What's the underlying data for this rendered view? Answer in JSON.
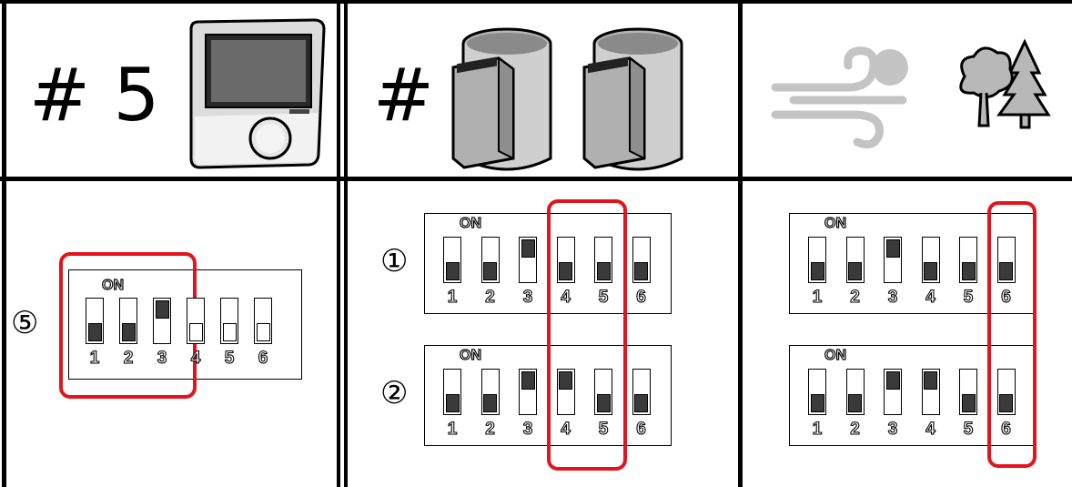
{
  "headers": {
    "col1_label": "# 5",
    "col2_label": "#"
  },
  "icons": {
    "col1": "thermostat-icon",
    "col2": "heating-unit-icon",
    "col3": [
      "wind-icon",
      "trees-icon"
    ]
  },
  "colors": {
    "highlight": "#e3141c",
    "lever": "#3a3a3a",
    "grey_icon": "#b8b8b8"
  },
  "dip_label_on": "ON",
  "switch_numbers": [
    "1",
    "2",
    "3",
    "4",
    "5",
    "6"
  ],
  "panels": {
    "col1": {
      "marker": "⑤",
      "switches": [
        "off",
        "off",
        "on",
        "off",
        "off",
        "off"
      ],
      "hollow": [
        false,
        false,
        false,
        true,
        true,
        true
      ],
      "highlight": "switches 1-3"
    },
    "col2": [
      {
        "marker": "①",
        "switches": [
          "off",
          "off",
          "on",
          "off",
          "off",
          "off"
        ]
      },
      {
        "marker": "②",
        "switches": [
          "off",
          "off",
          "on",
          "on",
          "off",
          "off"
        ]
      }
    ],
    "col2_highlight": "switches 4-5",
    "col3": [
      {
        "marker": "",
        "switches": [
          "off",
          "off",
          "on",
          "off",
          "off",
          "off"
        ]
      },
      {
        "marker": "",
        "switches": [
          "off",
          "off",
          "on",
          "on",
          "off",
          "off"
        ]
      }
    ],
    "col3_highlight": "switch 6"
  }
}
